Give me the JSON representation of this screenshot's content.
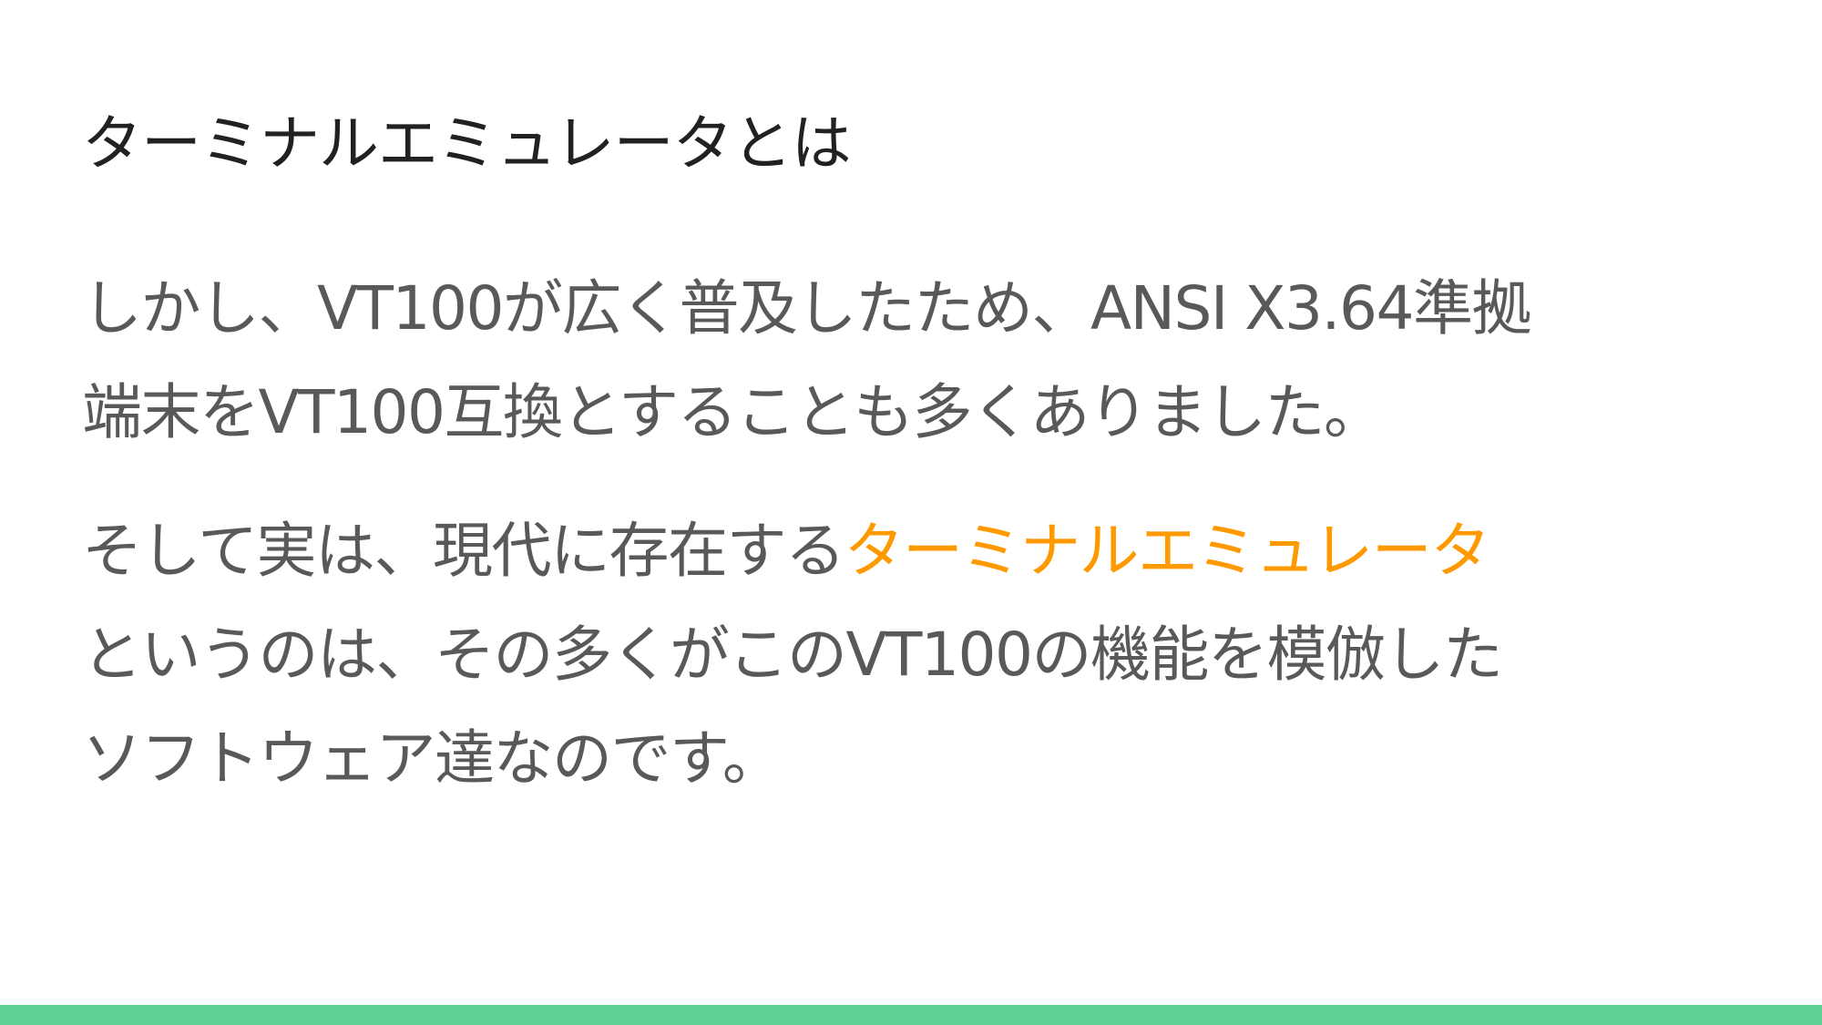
{
  "slide": {
    "title": "ターミナルエミュレータとは",
    "paragraphs": [
      {
        "lines": [
          "しかし、VT100が広く普及したため、ANSI X3.64準拠",
          "端末をVT100互換とすることも多くありました。"
        ]
      },
      {
        "line1_plain": "そして実は、現代に存在する",
        "line1_highlight": "ターミナルエミュレータ",
        "lines_rest": [
          "というのは、その多くがこのVT100の機能を模倣した",
          "ソフトウェア達なのです。"
        ]
      }
    ]
  },
  "colors": {
    "background": "#ffffff",
    "title": "#212121",
    "body_text": "#595959",
    "highlight": "#ff9900",
    "bottom_bar": "#5fd195"
  }
}
